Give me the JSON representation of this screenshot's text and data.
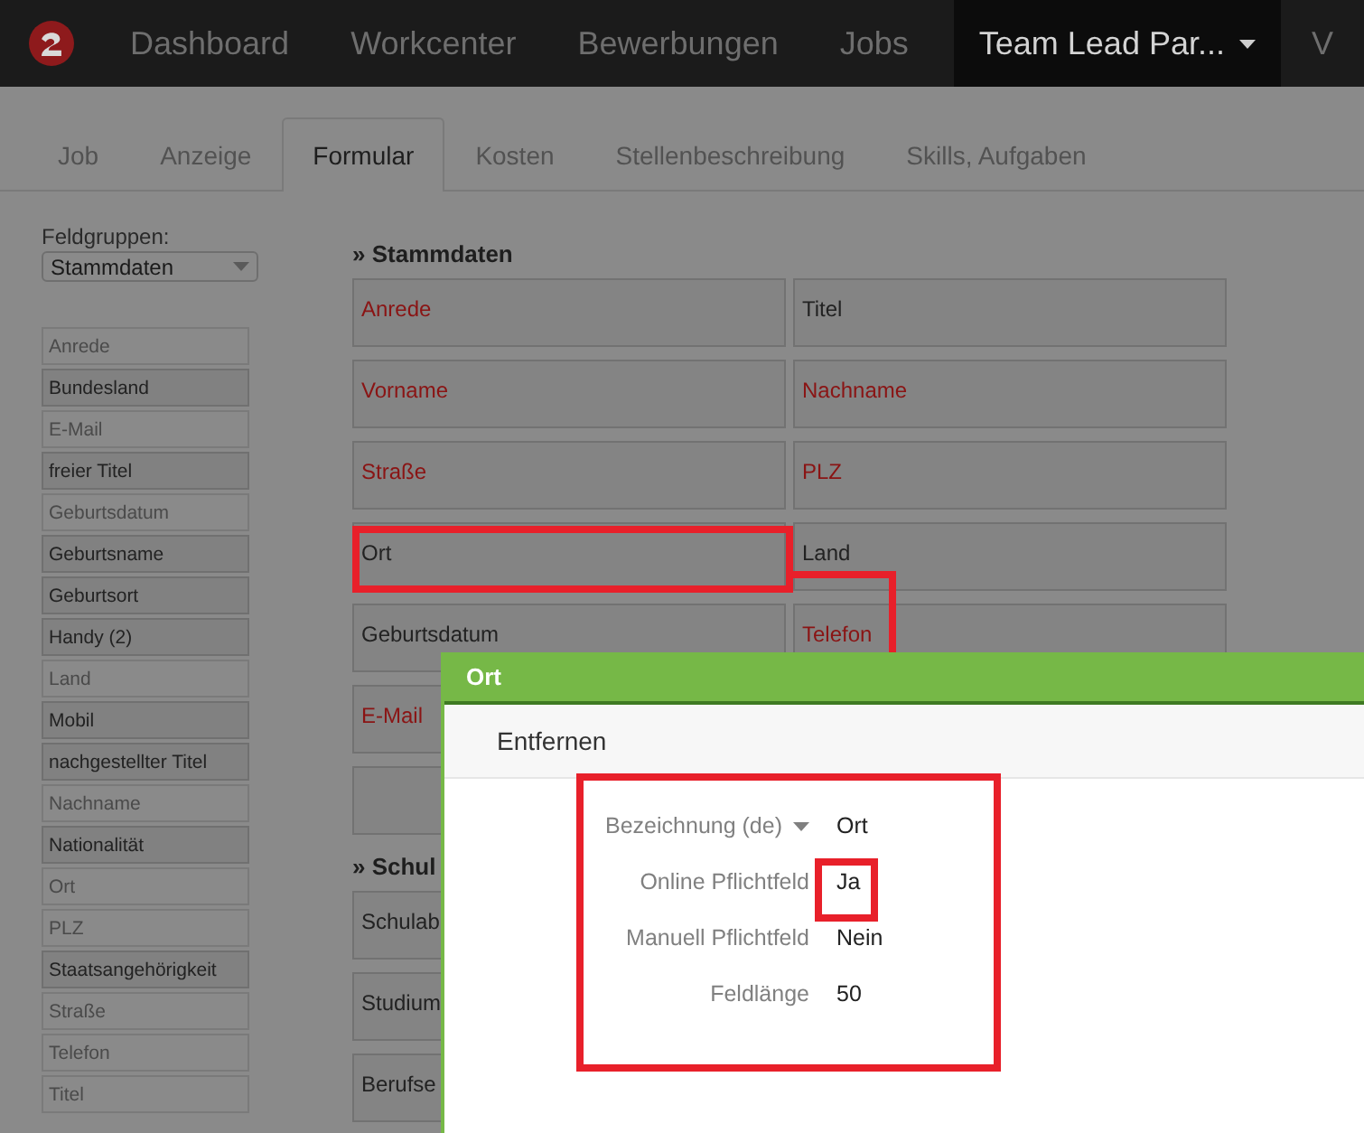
{
  "nav": {
    "items": [
      {
        "label": "Dashboard",
        "selected": false,
        "has_menu": false
      },
      {
        "label": "Workcenter",
        "selected": false,
        "has_menu": false
      },
      {
        "label": "Bewerbungen",
        "selected": false,
        "has_menu": false
      },
      {
        "label": "Jobs",
        "selected": false,
        "has_menu": false
      },
      {
        "label": "Team Lead Par...",
        "selected": true,
        "has_menu": true
      },
      {
        "label": "V",
        "selected": false,
        "has_menu": false
      }
    ]
  },
  "tabs": [
    {
      "label": "Job",
      "selected": false
    },
    {
      "label": "Anzeige",
      "selected": false
    },
    {
      "label": "Formular",
      "selected": true
    },
    {
      "label": "Kosten",
      "selected": false
    },
    {
      "label": "Stellenbeschreibung",
      "selected": false
    },
    {
      "label": "Skills, Aufgaben",
      "selected": false
    }
  ],
  "sidebar": {
    "label": "Feldgruppen:",
    "select": {
      "value": "Stammdaten"
    },
    "fields": [
      {
        "label": "Anrede",
        "placed": true
      },
      {
        "label": "Bundesland",
        "placed": false
      },
      {
        "label": "E-Mail",
        "placed": true
      },
      {
        "label": "freier Titel",
        "placed": false
      },
      {
        "label": "Geburtsdatum",
        "placed": true
      },
      {
        "label": "Geburtsname",
        "placed": false
      },
      {
        "label": "Geburtsort",
        "placed": false
      },
      {
        "label": "Handy (2)",
        "placed": false
      },
      {
        "label": "Land",
        "placed": true
      },
      {
        "label": "Mobil",
        "placed": false
      },
      {
        "label": "nachgestellter Titel",
        "placed": false
      },
      {
        "label": "Nachname",
        "placed": true
      },
      {
        "label": "Nationalität",
        "placed": false
      },
      {
        "label": "Ort",
        "placed": true
      },
      {
        "label": "PLZ",
        "placed": true
      },
      {
        "label": "Staatsangehörigkeit",
        "placed": false
      },
      {
        "label": "Straße",
        "placed": true
      },
      {
        "label": "Telefon",
        "placed": true
      },
      {
        "label": "Titel",
        "placed": true
      }
    ]
  },
  "sections": [
    {
      "title": "» Stammdaten",
      "rows": [
        [
          {
            "kind": "field",
            "label": "Anrede",
            "required": true
          },
          {
            "kind": "field",
            "label": "Titel",
            "required": false
          }
        ],
        [
          {
            "kind": "field",
            "label": "Vorname",
            "required": true
          },
          {
            "kind": "field",
            "label": "Nachname",
            "required": true
          }
        ],
        [
          {
            "kind": "field",
            "label": "Straße",
            "required": true
          },
          {
            "kind": "field",
            "label": "PLZ",
            "required": true
          }
        ],
        [
          {
            "kind": "field",
            "label": "Ort",
            "required": false
          },
          {
            "kind": "field",
            "label": "Land",
            "required": false
          }
        ],
        [
          {
            "kind": "field",
            "label": "Geburtsdatum",
            "required": false
          },
          {
            "kind": "field",
            "label": "Telefon",
            "required": true
          }
        ],
        [
          {
            "kind": "field",
            "label": "E-Mail",
            "required": true
          }
        ],
        [
          {
            "kind": "blank"
          }
        ]
      ]
    },
    {
      "title": "» Schul",
      "rows": [
        [
          {
            "kind": "field",
            "label": "Schulab",
            "required": false
          }
        ],
        [
          {
            "kind": "field",
            "label": "Studium",
            "required": false
          }
        ],
        [
          {
            "kind": "field",
            "label": "Berufse",
            "required": false
          }
        ]
      ]
    }
  ],
  "dialog": {
    "title": "Ort",
    "toolbar": [
      "Entfernen"
    ],
    "properties": [
      {
        "label": "Bezeichnung (de)",
        "dropdown": true,
        "value": "Ort"
      },
      {
        "label": "Online Pflichtfeld",
        "dropdown": false,
        "value": "Ja"
      },
      {
        "label": "Manuell Pflichtfeld",
        "dropdown": false,
        "value": "Nein"
      },
      {
        "label": "Feldlänge",
        "dropdown": false,
        "value": "50"
      }
    ]
  }
}
